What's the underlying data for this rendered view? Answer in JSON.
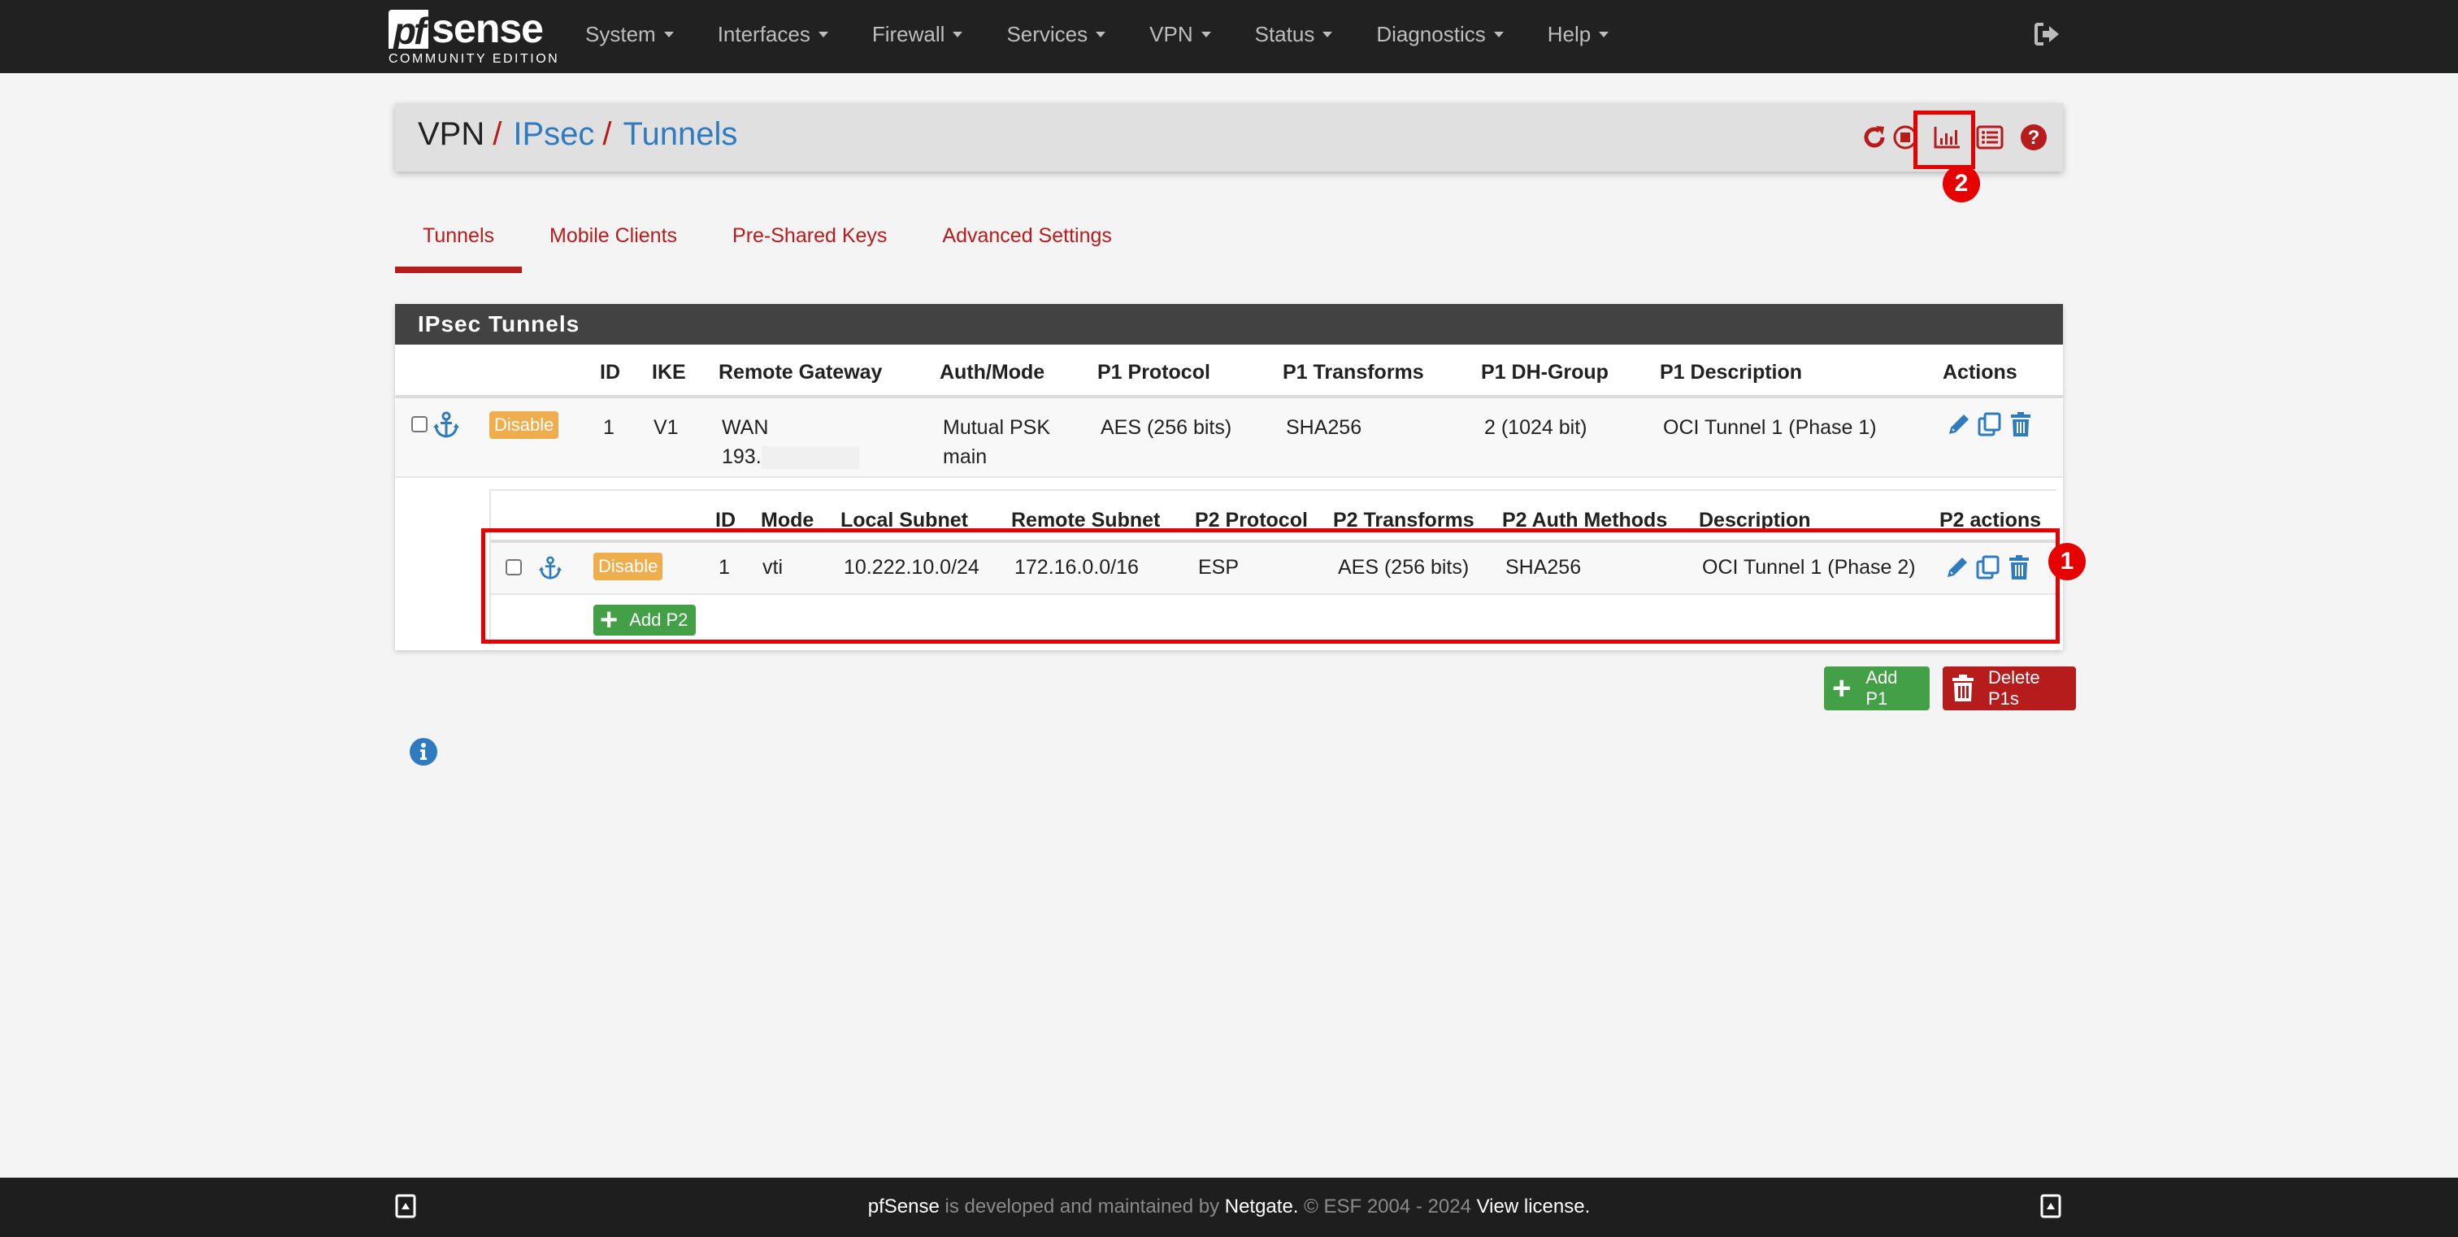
{
  "brand": {
    "logo_pf": "pf",
    "logo_sense": "sense",
    "edition": "COMMUNITY EDITION"
  },
  "nav": {
    "items": [
      {
        "label": "System"
      },
      {
        "label": "Interfaces"
      },
      {
        "label": "Firewall"
      },
      {
        "label": "Services"
      },
      {
        "label": "VPN"
      },
      {
        "label": "Status"
      },
      {
        "label": "Diagnostics"
      },
      {
        "label": "Help"
      }
    ],
    "logout_icon": "sign-out-icon"
  },
  "breadcrumb": {
    "root": "VPN",
    "separator": "/",
    "level1": "IPsec",
    "level2": "Tunnels",
    "icons": [
      "reload-icon",
      "stop-circle-icon",
      "bar-chart-icon",
      "list-icon",
      "help-icon"
    ]
  },
  "annotations": {
    "badge1": "1",
    "badge2": "2"
  },
  "tabs": [
    {
      "label": "Tunnels",
      "active": true
    },
    {
      "label": "Mobile Clients",
      "active": false
    },
    {
      "label": "Pre-Shared Keys",
      "active": false
    },
    {
      "label": "Advanced Settings",
      "active": false
    }
  ],
  "panel": {
    "title": "IPsec Tunnels",
    "p1_headers": [
      "ID",
      "IKE",
      "Remote Gateway",
      "Auth/Mode",
      "P1 Protocol",
      "P1 Transforms",
      "P1 DH-Group",
      "P1 Description",
      "Actions"
    ],
    "p1_rows": [
      {
        "disable_label": "Disable",
        "id": "1",
        "ike": "V1",
        "remote_gateway_line1": "WAN",
        "remote_gateway_line2": "193.",
        "auth_line1": "Mutual PSK",
        "auth_line2": "main",
        "protocol": "AES (256 bits)",
        "transforms": "SHA256",
        "dh_group": "2 (1024 bit)",
        "description": "OCI Tunnel 1 (Phase 1)"
      }
    ],
    "p2_headers": [
      "ID",
      "Mode",
      "Local Subnet",
      "Remote Subnet",
      "P2 Protocol",
      "P2 Transforms",
      "P2 Auth Methods",
      "Description",
      "P2 actions"
    ],
    "p2_rows": [
      {
        "disable_label": "Disable",
        "id": "1",
        "mode": "vti",
        "local_subnet": "10.222.10.0/24",
        "remote_subnet": "172.16.0.0/16",
        "protocol": "ESP",
        "transforms": "AES (256 bits)",
        "auth_methods": "SHA256",
        "description": "OCI Tunnel 1 (Phase 2)"
      }
    ],
    "add_p2_label": "Add P2"
  },
  "bottom_buttons": {
    "add_p1": "Add P1",
    "delete_p1s": "Delete P1s"
  },
  "footer": {
    "brand": "pfSense",
    "text1": " is developed and maintained by ",
    "company": "Netgate.",
    "text2": " © ESF 2004 - 2024 ",
    "license": "View license."
  },
  "colors": {
    "nav_bg": "#212121",
    "accent_red": "#b71c1c",
    "link_blue": "#2e7bbf",
    "disable_orange": "#f0ad4e",
    "add_green": "#43a047",
    "annotation_red": "#e60000"
  }
}
